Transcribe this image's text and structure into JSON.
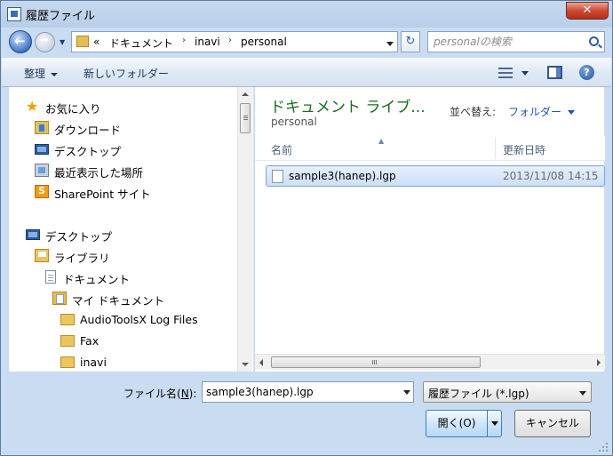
{
  "window": {
    "title": "履歴ファイル",
    "close_label": "✕"
  },
  "address": {
    "overflow": "«",
    "crumbs": [
      "ドキュメント",
      "inavi",
      "personal"
    ],
    "separator": "›",
    "refresh_glyph": "↻"
  },
  "search": {
    "placeholder": "personalの検索"
  },
  "toolbar": {
    "organize_label": "整理",
    "new_folder_label": "新しいフォルダー",
    "help_glyph": "?"
  },
  "navigation": {
    "favorites": [
      {
        "label": "お気に入り",
        "icon": "star-icon"
      },
      {
        "label": "ダウンロード",
        "icon": "downloads-folder-icon"
      },
      {
        "label": "デスクトップ",
        "icon": "desktop-icon"
      },
      {
        "label": "最近表示した場所",
        "icon": "recent-places-icon"
      },
      {
        "label": "SharePoint サイト",
        "icon": "sharepoint-icon"
      }
    ],
    "tree": [
      {
        "label": "デスクトップ",
        "icon": "desktop-icon"
      },
      {
        "label": "ライブラリ",
        "icon": "libraries-icon"
      },
      {
        "label": "ドキュメント",
        "icon": "documents-icon"
      },
      {
        "label": "マイ ドキュメント",
        "icon": "my-documents-icon"
      },
      {
        "label": "AudioToolsX Log Files",
        "icon": "folder-icon"
      },
      {
        "label": "Fax",
        "icon": "folder-icon"
      },
      {
        "label": "inavi",
        "icon": "folder-icon"
      }
    ]
  },
  "library": {
    "title": "ドキュメント ライブ...",
    "subtitle": "personal",
    "arrange_label": "並べ替え:",
    "arrange_value": "フォルダー"
  },
  "columns": {
    "name": "名前",
    "date_modified": "更新日時",
    "sort_glyph": "▲"
  },
  "files": [
    {
      "name": "sample3(hanep).lgp",
      "date_modified": "2013/11/08 14:15",
      "selected": true
    }
  ],
  "bottom": {
    "filename_label": "ファイル名(",
    "filename_accel": "N",
    "filename_label_end": "):",
    "filename_value": "sample3(hanep).lgp",
    "filter_value": "履歴ファイル (*.lgp)",
    "open_label": "開く(O)",
    "cancel_label": "キャンセル"
  },
  "colors": {
    "frame": "#c9dcf2",
    "library_title": "#1e6b21",
    "link_blue": "#1f54b0",
    "selection_border": "#7da2ce"
  }
}
